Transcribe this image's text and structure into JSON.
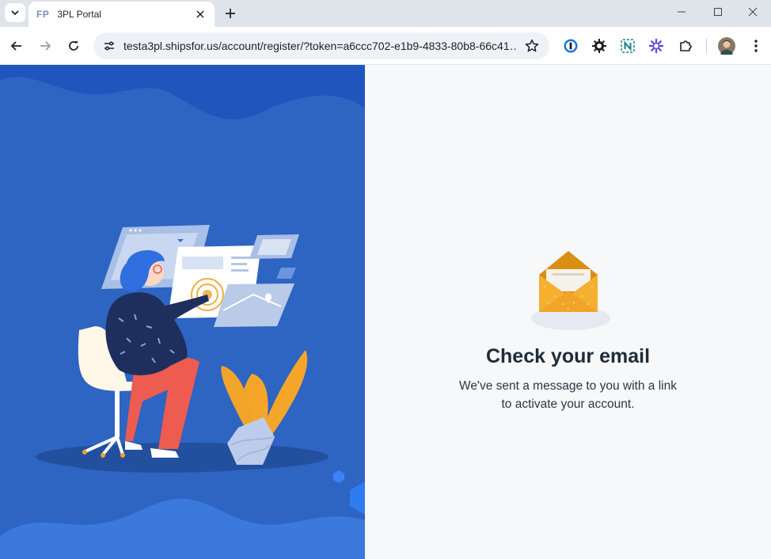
{
  "browser": {
    "tab_favicon": "FP",
    "tab_title": "3PL Portal",
    "url": "testa3pl.shipsfor.us/account/register/?token=a6ccc702-e1b9-4833-80b8-66c41…",
    "icons": [
      "tab-search-icon",
      "close-icon",
      "new-tab-icon",
      "back-icon",
      "forward-icon",
      "reload-icon",
      "site-settings-icon",
      "star-icon",
      "password-manager-icon",
      "gear-icon",
      "n-extension-icon",
      "sparkle-extension-icon",
      "extensions-puzzle-icon",
      "profile-avatar",
      "more-menu-icon"
    ]
  },
  "confirmation": {
    "heading": "Check your email",
    "message_line1": "We've sent a message to you with a link",
    "message_line2": "to activate your account."
  },
  "colors": {
    "panel_blue": "#2e64c2",
    "accent_orange": "#f0a42a",
    "heading": "#1f2b36"
  }
}
